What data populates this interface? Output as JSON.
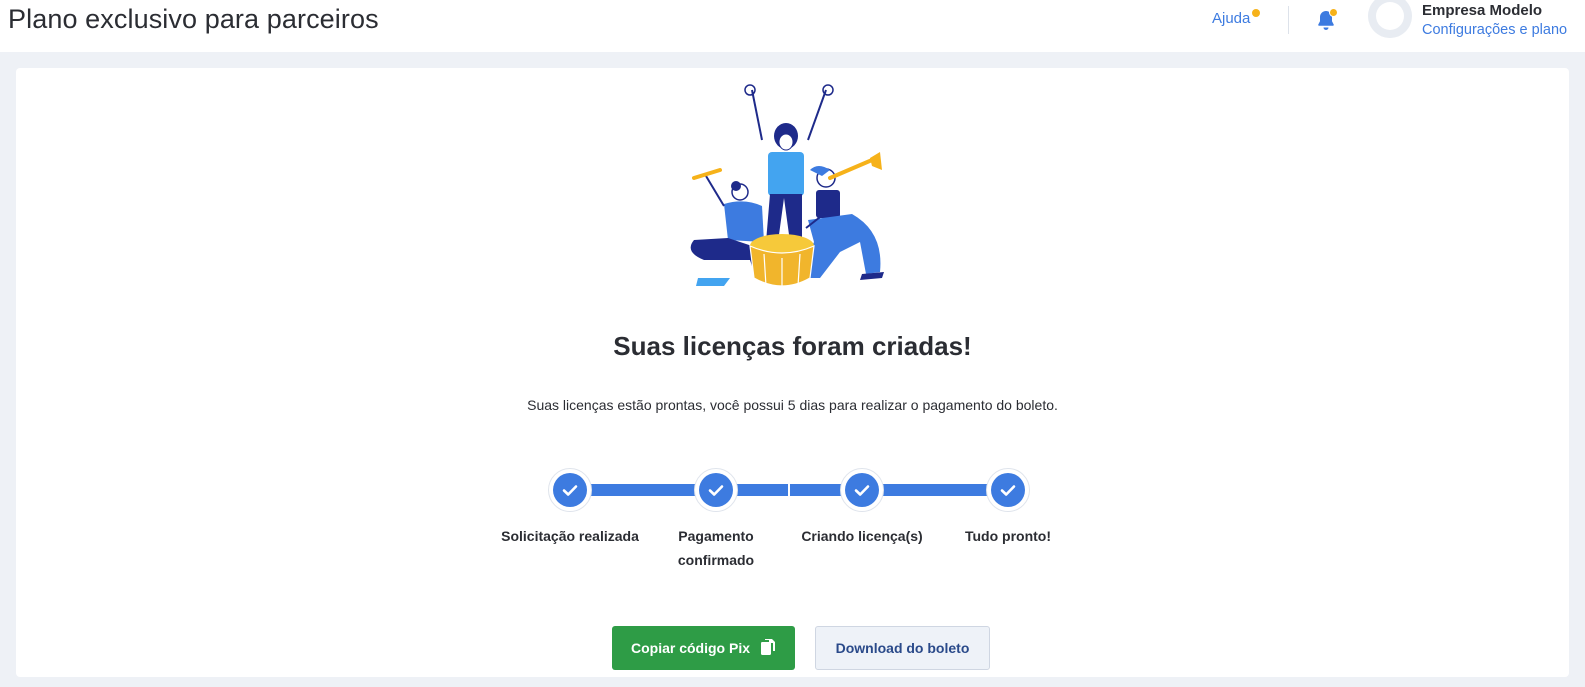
{
  "header": {
    "title": "Plano exclusivo para parceiros",
    "help_label": "Ajuda",
    "company_name": "Empresa Modelo",
    "settings_link": "Configurações e plano"
  },
  "main": {
    "headline": "Suas licenças foram criadas!",
    "description": "Suas licenças estão prontas, você possui 5 dias para realizar o pagamento do boleto."
  },
  "steps": [
    {
      "label": "Solicitação realizada",
      "status": "done"
    },
    {
      "label": "Pagamento confirmado",
      "status": "done"
    },
    {
      "label": "Criando licença(s)",
      "status": "done"
    },
    {
      "label": "Tudo pronto!",
      "status": "done"
    }
  ],
  "actions": {
    "copy_pix_label": "Copiar código Pix",
    "download_boleto_label": "Download do boleto"
  },
  "colors": {
    "accent": "#3d7be0",
    "notification_dot": "#f6b21a",
    "primary_button": "#2e9c46"
  },
  "icons": {
    "notifications": "bell-icon",
    "copy": "copy-icon",
    "step_done": "check-icon"
  }
}
